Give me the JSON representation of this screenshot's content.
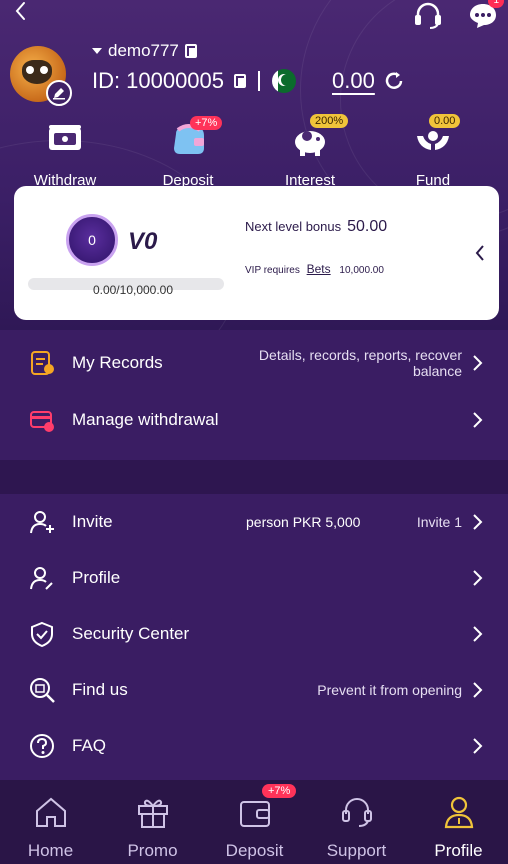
{
  "user": {
    "name": "demo777",
    "id_label": "ID:",
    "id": "10000005",
    "balance": "0.00"
  },
  "header": {
    "message_badge": "1"
  },
  "actions": [
    {
      "label": "Withdraw",
      "tag": ""
    },
    {
      "label": "Deposit",
      "tag": "+7%"
    },
    {
      "label": "Interest",
      "tag": "200%"
    },
    {
      "label": "Fund",
      "tag": "0.00"
    }
  ],
  "vip": {
    "badge": "0",
    "level": "V0",
    "progress_text": "0.00/10,000.00",
    "progress_fraction": 0,
    "next_bonus_label": "Next level bonus",
    "next_bonus_value": "50.00",
    "requires_label": "VIP requires",
    "bets_label": "Bets",
    "requires_value": "10,000.00"
  },
  "menu1": [
    {
      "label": "My Records",
      "value": "Details, records, reports, recover balance"
    },
    {
      "label": "Manage withdrawal",
      "value": ""
    }
  ],
  "menu2": [
    {
      "label": "Invite",
      "mid": "person PKR 5,000",
      "value": "Invite 1"
    },
    {
      "label": "Profile",
      "mid": "",
      "value": ""
    },
    {
      "label": "Security Center",
      "mid": "",
      "value": ""
    },
    {
      "label": "Find us",
      "mid": "",
      "value": "Prevent it from opening"
    },
    {
      "label": "FAQ",
      "mid": "",
      "value": ""
    }
  ],
  "nav": [
    {
      "label": "Home"
    },
    {
      "label": "Promo"
    },
    {
      "label": "Deposit",
      "tag": "+7%"
    },
    {
      "label": "Support"
    },
    {
      "label": "Profile"
    }
  ],
  "colors": {
    "accent_gold": "#f0c43a",
    "badge_red": "#ff3359",
    "background": "#3a1d63"
  },
  "icons": [
    "back-arrow-icon",
    "headset-icon",
    "chat-icon",
    "edit-icon",
    "copy-icon",
    "pakistan-flag-icon",
    "refresh-icon",
    "wallet-withdraw-icon",
    "deposit-bag-icon",
    "piggy-bank-icon",
    "hands-fund-icon",
    "vip-badge-icon",
    "records-icon",
    "withdrawal-card-icon",
    "invite-user-icon",
    "profile-user-icon",
    "shield-icon",
    "find-us-icon",
    "faq-icon",
    "home-icon",
    "gift-icon",
    "wallet-icon",
    "support-headset-icon",
    "person-icon",
    "chevron-right-icon",
    "chevron-left-icon"
  ]
}
